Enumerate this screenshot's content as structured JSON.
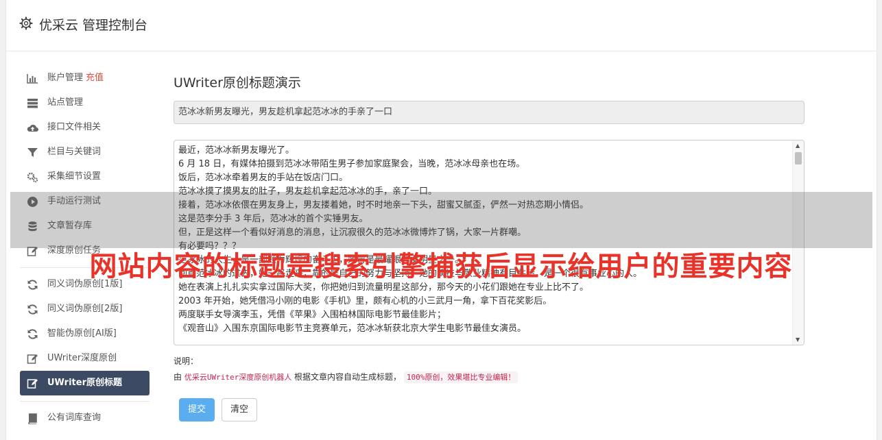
{
  "header": {
    "title": "优采云 管理控制台",
    "icon": "gear-icon"
  },
  "sidebar": {
    "group1": [
      {
        "label": "账户管理",
        "badge": "充值",
        "icon": "bar-chart-icon"
      },
      {
        "label": "站点管理",
        "icon": "server-icon"
      },
      {
        "label": "接口文件相关",
        "icon": "cloud-upload-icon"
      },
      {
        "label": "栏目与关键词",
        "icon": "filter-icon"
      },
      {
        "label": "采集细节设置",
        "icon": "cogs-icon"
      },
      {
        "label": "手动运行测试",
        "icon": "play-circle-icon"
      },
      {
        "label": "文章暂存库",
        "icon": "database-icon"
      },
      {
        "label": "深度原创任务",
        "icon": "edit-icon"
      }
    ],
    "group2": [
      {
        "label": "同义词伪原创[1版]",
        "icon": "refresh-icon"
      },
      {
        "label": "同义词伪原创[2版]",
        "icon": "refresh-icon"
      },
      {
        "label": "智能伪原创[AI版]",
        "icon": "refresh-icon"
      },
      {
        "label": "UWriter深度原创",
        "icon": "edit-icon"
      },
      {
        "label": "UWriter原创标题",
        "icon": "edit-icon",
        "active": true
      }
    ],
    "group3": [
      {
        "label": "公有词库查询",
        "icon": "book-icon"
      }
    ]
  },
  "main": {
    "page_title": "UWriter原创标题演示",
    "title_value": "范冰冰新男友曝光，男友趁机拿起范冰冰的手亲了一口",
    "content_lines": [
      "最近，范冰冰新男友曝光了。",
      "6 月 18 日，有媒体拍摄到范冰冰带陌生男子参加家庭聚会，当晚，范冰冰母亲也在场。",
      "饭后，范冰冰牵着男友的手站在饭店门口。",
      "范冰冰摸了摸男友的肚子，男友趁机拿起范冰冰的手，亲了一口。",
      "接着，范冰冰依偎在男友身上，男友搂着她，时不时地亲一下头，甜蜜又腻歪，俨然一对热恋期小情侣。",
      "这是范李分手 3 年后，范冰冰的首个实锤男友。",
      "但，正是这样一个看似好消息的消息，让沉寂很久的范冰冰微博炸了锅，大家一片群嘲。",
      "有必要吗？？？",
      "范冰冰的人生，是一部颇为辉煌的奋斗史，她曾是最耀眼的女明星之一。",
      "回首范冰冰的过去，她一路走来，靠的是自己的努力与坚持，她的演技与敬业精神有目共睹，是一个很有事业心的人。",
      "她在表演上扎扎实实拿过国际大奖，你把她归到流量明星这部分，那今天的小花们跟她在专业上比不了。",
      "2003 年开始，她凭借冯小刚的电影《手机》里，颇有心机的小三武月一角，拿下百花奖影后。",
      "两度联手女导演李玉，凭借《苹果》入围柏林国际电影节最佳影片；",
      "《观音山》入围东京国际电影节主竞赛单元，范冰冰斩获北京大学生电影节最佳女演员。"
    ],
    "explain_label": "说明：",
    "explain_prefix": "由",
    "explain_robot": "优采云UWriter深度原创机器人",
    "explain_middle": "根据文章内容自动生成标题，",
    "explain_badge": "100%原创，效果堪比专业编辑！",
    "submit_label": "提交",
    "clear_label": "清空"
  },
  "watermark": "网站内容的标题是搜索引擎捕获后显示给用户的重要内容"
}
